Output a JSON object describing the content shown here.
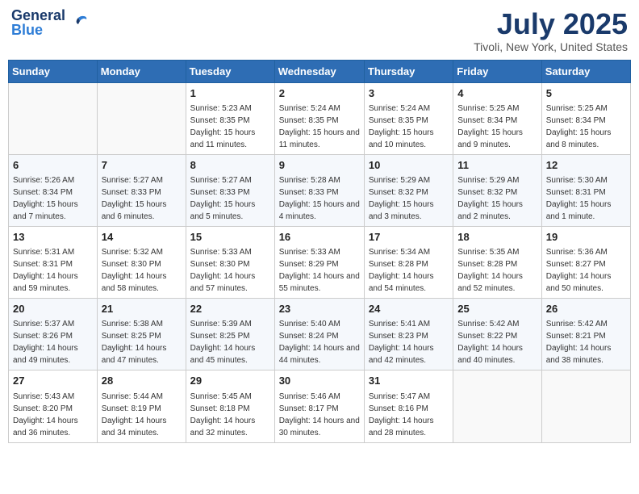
{
  "header": {
    "logo_line1": "General",
    "logo_line2": "Blue",
    "month": "July 2025",
    "location": "Tivoli, New York, United States"
  },
  "weekdays": [
    "Sunday",
    "Monday",
    "Tuesday",
    "Wednesday",
    "Thursday",
    "Friday",
    "Saturday"
  ],
  "weeks": [
    [
      {
        "day": "",
        "info": ""
      },
      {
        "day": "",
        "info": ""
      },
      {
        "day": "1",
        "info": "Sunrise: 5:23 AM\nSunset: 8:35 PM\nDaylight: 15 hours and 11 minutes."
      },
      {
        "day": "2",
        "info": "Sunrise: 5:24 AM\nSunset: 8:35 PM\nDaylight: 15 hours and 11 minutes."
      },
      {
        "day": "3",
        "info": "Sunrise: 5:24 AM\nSunset: 8:35 PM\nDaylight: 15 hours and 10 minutes."
      },
      {
        "day": "4",
        "info": "Sunrise: 5:25 AM\nSunset: 8:34 PM\nDaylight: 15 hours and 9 minutes."
      },
      {
        "day": "5",
        "info": "Sunrise: 5:25 AM\nSunset: 8:34 PM\nDaylight: 15 hours and 8 minutes."
      }
    ],
    [
      {
        "day": "6",
        "info": "Sunrise: 5:26 AM\nSunset: 8:34 PM\nDaylight: 15 hours and 7 minutes."
      },
      {
        "day": "7",
        "info": "Sunrise: 5:27 AM\nSunset: 8:33 PM\nDaylight: 15 hours and 6 minutes."
      },
      {
        "day": "8",
        "info": "Sunrise: 5:27 AM\nSunset: 8:33 PM\nDaylight: 15 hours and 5 minutes."
      },
      {
        "day": "9",
        "info": "Sunrise: 5:28 AM\nSunset: 8:33 PM\nDaylight: 15 hours and 4 minutes."
      },
      {
        "day": "10",
        "info": "Sunrise: 5:29 AM\nSunset: 8:32 PM\nDaylight: 15 hours and 3 minutes."
      },
      {
        "day": "11",
        "info": "Sunrise: 5:29 AM\nSunset: 8:32 PM\nDaylight: 15 hours and 2 minutes."
      },
      {
        "day": "12",
        "info": "Sunrise: 5:30 AM\nSunset: 8:31 PM\nDaylight: 15 hours and 1 minute."
      }
    ],
    [
      {
        "day": "13",
        "info": "Sunrise: 5:31 AM\nSunset: 8:31 PM\nDaylight: 14 hours and 59 minutes."
      },
      {
        "day": "14",
        "info": "Sunrise: 5:32 AM\nSunset: 8:30 PM\nDaylight: 14 hours and 58 minutes."
      },
      {
        "day": "15",
        "info": "Sunrise: 5:33 AM\nSunset: 8:30 PM\nDaylight: 14 hours and 57 minutes."
      },
      {
        "day": "16",
        "info": "Sunrise: 5:33 AM\nSunset: 8:29 PM\nDaylight: 14 hours and 55 minutes."
      },
      {
        "day": "17",
        "info": "Sunrise: 5:34 AM\nSunset: 8:28 PM\nDaylight: 14 hours and 54 minutes."
      },
      {
        "day": "18",
        "info": "Sunrise: 5:35 AM\nSunset: 8:28 PM\nDaylight: 14 hours and 52 minutes."
      },
      {
        "day": "19",
        "info": "Sunrise: 5:36 AM\nSunset: 8:27 PM\nDaylight: 14 hours and 50 minutes."
      }
    ],
    [
      {
        "day": "20",
        "info": "Sunrise: 5:37 AM\nSunset: 8:26 PM\nDaylight: 14 hours and 49 minutes."
      },
      {
        "day": "21",
        "info": "Sunrise: 5:38 AM\nSunset: 8:25 PM\nDaylight: 14 hours and 47 minutes."
      },
      {
        "day": "22",
        "info": "Sunrise: 5:39 AM\nSunset: 8:25 PM\nDaylight: 14 hours and 45 minutes."
      },
      {
        "day": "23",
        "info": "Sunrise: 5:40 AM\nSunset: 8:24 PM\nDaylight: 14 hours and 44 minutes."
      },
      {
        "day": "24",
        "info": "Sunrise: 5:41 AM\nSunset: 8:23 PM\nDaylight: 14 hours and 42 minutes."
      },
      {
        "day": "25",
        "info": "Sunrise: 5:42 AM\nSunset: 8:22 PM\nDaylight: 14 hours and 40 minutes."
      },
      {
        "day": "26",
        "info": "Sunrise: 5:42 AM\nSunset: 8:21 PM\nDaylight: 14 hours and 38 minutes."
      }
    ],
    [
      {
        "day": "27",
        "info": "Sunrise: 5:43 AM\nSunset: 8:20 PM\nDaylight: 14 hours and 36 minutes."
      },
      {
        "day": "28",
        "info": "Sunrise: 5:44 AM\nSunset: 8:19 PM\nDaylight: 14 hours and 34 minutes."
      },
      {
        "day": "29",
        "info": "Sunrise: 5:45 AM\nSunset: 8:18 PM\nDaylight: 14 hours and 32 minutes."
      },
      {
        "day": "30",
        "info": "Sunrise: 5:46 AM\nSunset: 8:17 PM\nDaylight: 14 hours and 30 minutes."
      },
      {
        "day": "31",
        "info": "Sunrise: 5:47 AM\nSunset: 8:16 PM\nDaylight: 14 hours and 28 minutes."
      },
      {
        "day": "",
        "info": ""
      },
      {
        "day": "",
        "info": ""
      }
    ]
  ]
}
